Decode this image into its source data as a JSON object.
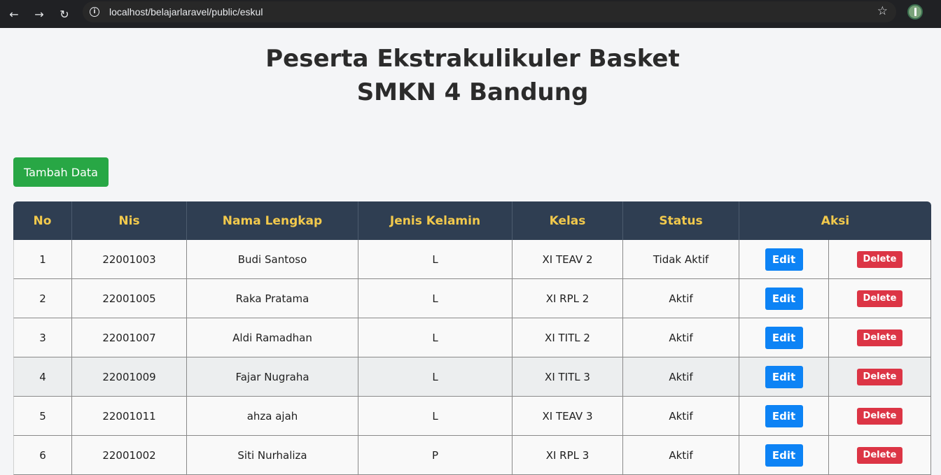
{
  "browser": {
    "url": "localhost/belajarlaravel/public/eskul",
    "back_icon": "←",
    "forward_icon": "→",
    "reload_icon": "↻",
    "star_icon": "☆",
    "menu_icon": "⋮"
  },
  "page": {
    "title_line1": "Peserta Ekstrakulikuler Basket",
    "title_line2": "SMKN 4 Bandung",
    "add_button": "Tambah Data"
  },
  "table": {
    "headers": [
      "No",
      "Nis",
      "Nama Lengkap",
      "Jenis Kelamin",
      "Kelas",
      "Status",
      "Aksi"
    ],
    "edit_label": "Edit",
    "delete_label": "Delete",
    "rows": [
      {
        "no": "1",
        "nis": "22001003",
        "nama": "Budi Santoso",
        "jk": "L",
        "kelas": "XI TEAV 2",
        "status": "Tidak Aktif"
      },
      {
        "no": "2",
        "nis": "22001005",
        "nama": "Raka Pratama",
        "jk": "L",
        "kelas": "XI RPL 2",
        "status": "Aktif"
      },
      {
        "no": "3",
        "nis": "22001007",
        "nama": "Aldi Ramadhan",
        "jk": "L",
        "kelas": "XI TITL 2",
        "status": "Aktif"
      },
      {
        "no": "4",
        "nis": "22001009",
        "nama": "Fajar Nugraha",
        "jk": "L",
        "kelas": "XI TITL 3",
        "status": "Aktif"
      },
      {
        "no": "5",
        "nis": "22001011",
        "nama": "ahza ajah",
        "jk": "L",
        "kelas": "XI TEAV 3",
        "status": "Aktif"
      },
      {
        "no": "6",
        "nis": "22001002",
        "nama": "Siti Nurhaliza",
        "jk": "P",
        "kelas": "XI RPL 3",
        "status": "Aktif"
      }
    ]
  },
  "colors": {
    "header_bg": "#2f3e52",
    "header_text": "#f2c94c",
    "add_button": "#28a745",
    "edit_button": "#0d83f5",
    "delete_button": "#dc3545"
  }
}
